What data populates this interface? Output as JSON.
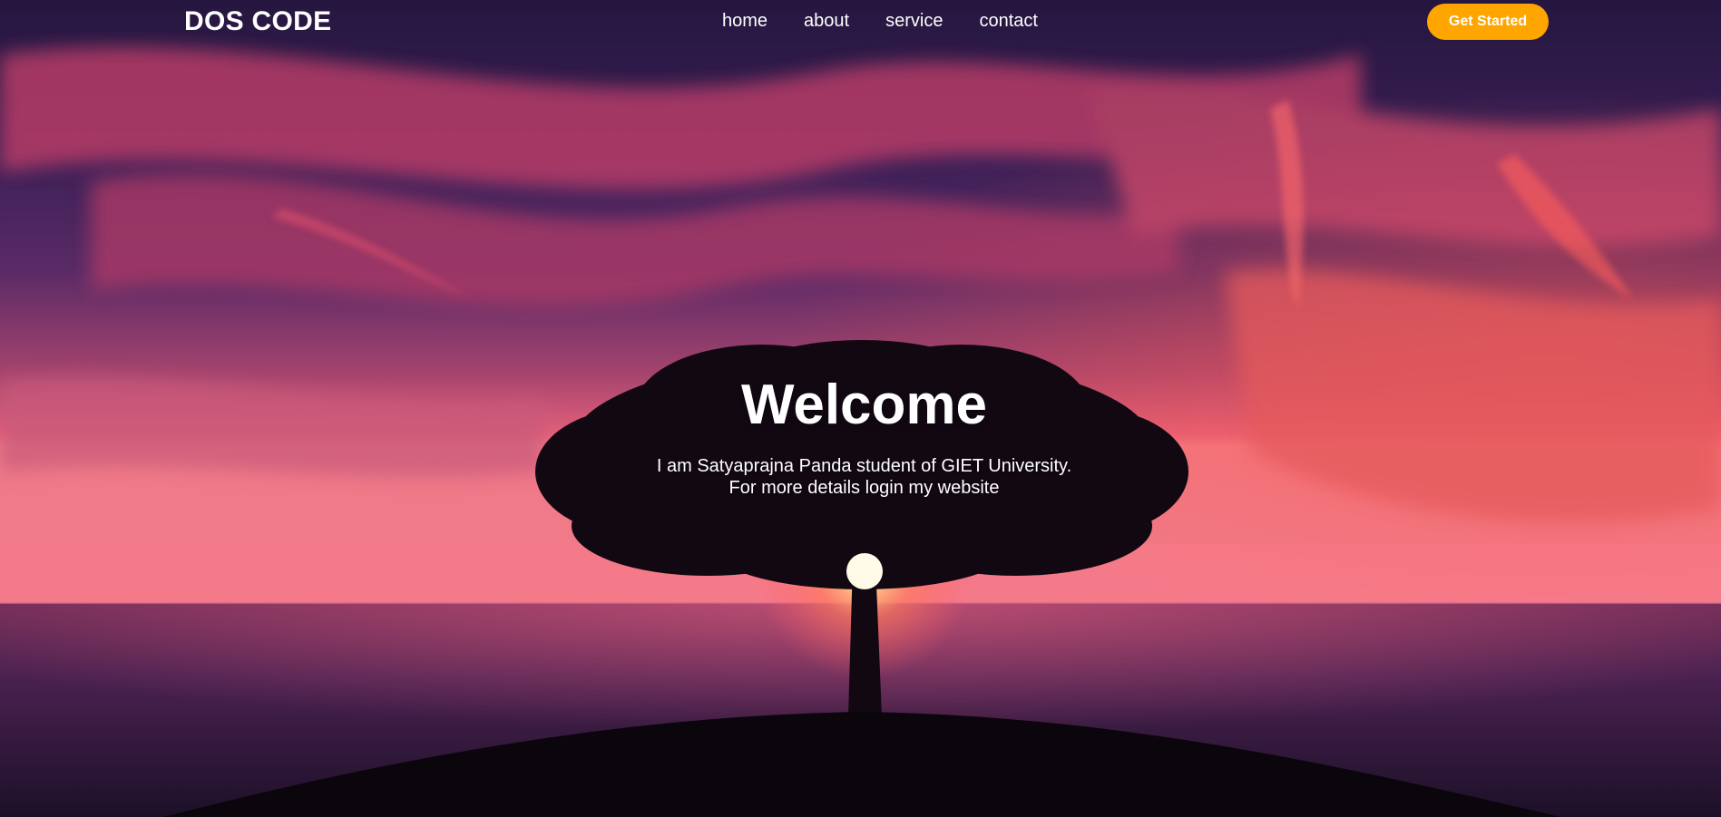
{
  "header": {
    "logo_text": "DOS CODE",
    "nav": [
      {
        "label": "home"
      },
      {
        "label": "about"
      },
      {
        "label": "service"
      },
      {
        "label": "contact"
      }
    ],
    "cta_label": "Get Started"
  },
  "hero": {
    "title": "Welcome",
    "lines": [
      "I am Satyaprajna Panda student of GIET University.",
      "For more details login my website"
    ],
    "background_image": "sunset-tree-over-sea"
  },
  "colors": {
    "accent": "#ffa500",
    "text": "#ffffff",
    "sky_top": "#2a1e4a",
    "cloud": "#e0456a",
    "horizon": "#f0607a",
    "sea": "#3a1f44"
  }
}
